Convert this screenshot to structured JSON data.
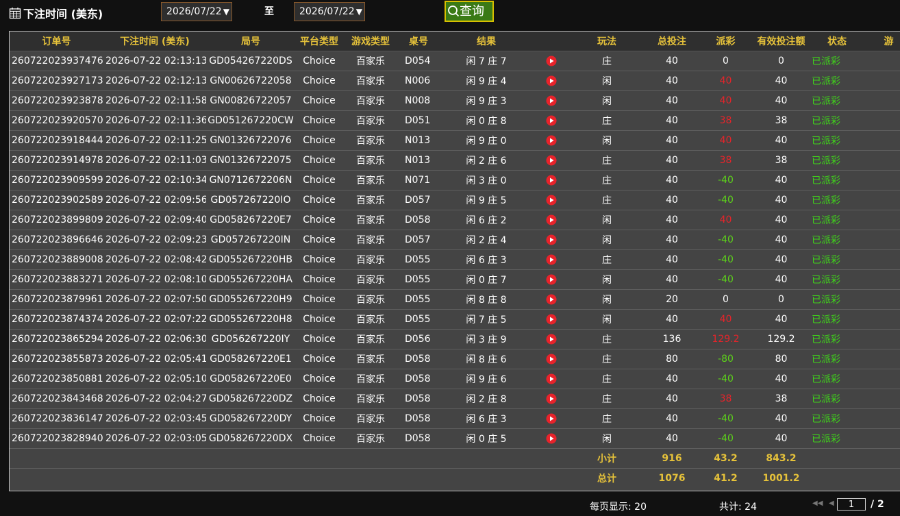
{
  "filter": {
    "label": "下注时间 (美东)",
    "start_date": "2026/07/22",
    "to_label": "至",
    "end_date": "2026/07/22",
    "query_label": "查询"
  },
  "table": {
    "headers": [
      "订单号",
      "下注时间 (美东)",
      "局号",
      "平台类型",
      "游戏类型",
      "桌号",
      "结果",
      "",
      "玩法",
      "总投注",
      "派彩",
      "有效投注额",
      "状态",
      "游"
    ],
    "rows": [
      {
        "order": "260722023937476",
        "time": "2026-07-22 02:13:13",
        "round": "GD054267220DS",
        "platform": "Choice",
        "game": "百家乐",
        "table": "D054",
        "result": "闲 7 庄 7",
        "bet": "庄",
        "stake": "40",
        "payout": "0",
        "payout_type": "zero",
        "valid": "0",
        "status": "已派彩"
      },
      {
        "order": "260722023927173",
        "time": "2026-07-22 02:12:13",
        "round": "GN00626722058",
        "platform": "Choice",
        "game": "百家乐",
        "table": "N006",
        "result": "闲 9 庄 4",
        "bet": "闲",
        "stake": "40",
        "payout": "40",
        "payout_type": "win",
        "valid": "40",
        "status": "已派彩"
      },
      {
        "order": "260722023923878",
        "time": "2026-07-22 02:11:58",
        "round": "GN00826722057",
        "platform": "Choice",
        "game": "百家乐",
        "table": "N008",
        "result": "闲 9 庄 3",
        "bet": "闲",
        "stake": "40",
        "payout": "40",
        "payout_type": "win",
        "valid": "40",
        "status": "已派彩"
      },
      {
        "order": "260722023920570",
        "time": "2026-07-22 02:11:36",
        "round": "GD051267220CW",
        "platform": "Choice",
        "game": "百家乐",
        "table": "D051",
        "result": "闲 0 庄 8",
        "bet": "庄",
        "stake": "40",
        "payout": "38",
        "payout_type": "win",
        "valid": "38",
        "status": "已派彩"
      },
      {
        "order": "260722023918444",
        "time": "2026-07-22 02:11:25",
        "round": "GN01326722076",
        "platform": "Choice",
        "game": "百家乐",
        "table": "N013",
        "result": "闲 9 庄 0",
        "bet": "闲",
        "stake": "40",
        "payout": "40",
        "payout_type": "win",
        "valid": "40",
        "status": "已派彩"
      },
      {
        "order": "260722023914978",
        "time": "2026-07-22 02:11:03",
        "round": "GN01326722075",
        "platform": "Choice",
        "game": "百家乐",
        "table": "N013",
        "result": "闲 2 庄 6",
        "bet": "庄",
        "stake": "40",
        "payout": "38",
        "payout_type": "win",
        "valid": "38",
        "status": "已派彩"
      },
      {
        "order": "260722023909599",
        "time": "2026-07-22 02:10:34",
        "round": "GN0712672206N",
        "platform": "Choice",
        "game": "百家乐",
        "table": "N071",
        "result": "闲 3 庄 0",
        "bet": "庄",
        "stake": "40",
        "payout": "-40",
        "payout_type": "neg",
        "valid": "40",
        "status": "已派彩"
      },
      {
        "order": "260722023902589",
        "time": "2026-07-22 02:09:56",
        "round": "GD057267220IO",
        "platform": "Choice",
        "game": "百家乐",
        "table": "D057",
        "result": "闲 9 庄 5",
        "bet": "庄",
        "stake": "40",
        "payout": "-40",
        "payout_type": "neg",
        "valid": "40",
        "status": "已派彩"
      },
      {
        "order": "260722023899809",
        "time": "2026-07-22 02:09:40",
        "round": "GD058267220E7",
        "platform": "Choice",
        "game": "百家乐",
        "table": "D058",
        "result": "闲 6 庄 2",
        "bet": "闲",
        "stake": "40",
        "payout": "40",
        "payout_type": "win",
        "valid": "40",
        "status": "已派彩"
      },
      {
        "order": "260722023896646",
        "time": "2026-07-22 02:09:23",
        "round": "GD057267220IN",
        "platform": "Choice",
        "game": "百家乐",
        "table": "D057",
        "result": "闲 2 庄 4",
        "bet": "闲",
        "stake": "40",
        "payout": "-40",
        "payout_type": "neg",
        "valid": "40",
        "status": "已派彩"
      },
      {
        "order": "260722023889008",
        "time": "2026-07-22 02:08:42",
        "round": "GD055267220HB",
        "platform": "Choice",
        "game": "百家乐",
        "table": "D055",
        "result": "闲 6 庄 3",
        "bet": "庄",
        "stake": "40",
        "payout": "-40",
        "payout_type": "neg",
        "valid": "40",
        "status": "已派彩"
      },
      {
        "order": "260722023883271",
        "time": "2026-07-22 02:08:10",
        "round": "GD055267220HA",
        "platform": "Choice",
        "game": "百家乐",
        "table": "D055",
        "result": "闲 0 庄 7",
        "bet": "闲",
        "stake": "40",
        "payout": "-40",
        "payout_type": "neg",
        "valid": "40",
        "status": "已派彩"
      },
      {
        "order": "260722023879961",
        "time": "2026-07-22 02:07:50",
        "round": "GD055267220H9",
        "platform": "Choice",
        "game": "百家乐",
        "table": "D055",
        "result": "闲 8 庄 8",
        "bet": "闲",
        "stake": "20",
        "payout": "0",
        "payout_type": "zero",
        "valid": "0",
        "status": "已派彩"
      },
      {
        "order": "260722023874374",
        "time": "2026-07-22 02:07:22",
        "round": "GD055267220H8",
        "platform": "Choice",
        "game": "百家乐",
        "table": "D055",
        "result": "闲 7 庄 5",
        "bet": "闲",
        "stake": "40",
        "payout": "40",
        "payout_type": "win",
        "valid": "40",
        "status": "已派彩"
      },
      {
        "order": "260722023865294",
        "time": "2026-07-22 02:06:30",
        "round": "GD056267220IY",
        "platform": "Choice",
        "game": "百家乐",
        "table": "D056",
        "result": "闲 3 庄 9",
        "bet": "庄",
        "stake": "136",
        "payout": "129.2",
        "payout_type": "win",
        "valid": "129.2",
        "status": "已派彩"
      },
      {
        "order": "260722023855873",
        "time": "2026-07-22 02:05:41",
        "round": "GD058267220E1",
        "platform": "Choice",
        "game": "百家乐",
        "table": "D058",
        "result": "闲 8 庄 6",
        "bet": "庄",
        "stake": "80",
        "payout": "-80",
        "payout_type": "neg",
        "valid": "80",
        "status": "已派彩"
      },
      {
        "order": "260722023850881",
        "time": "2026-07-22 02:05:10",
        "round": "GD058267220E0",
        "platform": "Choice",
        "game": "百家乐",
        "table": "D058",
        "result": "闲 9 庄 6",
        "bet": "庄",
        "stake": "40",
        "payout": "-40",
        "payout_type": "neg",
        "valid": "40",
        "status": "已派彩"
      },
      {
        "order": "260722023843468",
        "time": "2026-07-22 02:04:27",
        "round": "GD058267220DZ",
        "platform": "Choice",
        "game": "百家乐",
        "table": "D058",
        "result": "闲 2 庄 8",
        "bet": "庄",
        "stake": "40",
        "payout": "38",
        "payout_type": "win",
        "valid": "38",
        "status": "已派彩"
      },
      {
        "order": "260722023836147",
        "time": "2026-07-22 02:03:45",
        "round": "GD058267220DY",
        "platform": "Choice",
        "game": "百家乐",
        "table": "D058",
        "result": "闲 6 庄 3",
        "bet": "庄",
        "stake": "40",
        "payout": "-40",
        "payout_type": "neg",
        "valid": "40",
        "status": "已派彩"
      },
      {
        "order": "260722023828940",
        "time": "2026-07-22 02:03:05",
        "round": "GD058267220DX",
        "platform": "Choice",
        "game": "百家乐",
        "table": "D058",
        "result": "闲 0 庄 5",
        "bet": "闲",
        "stake": "40",
        "payout": "-40",
        "payout_type": "neg",
        "valid": "40",
        "status": "已派彩"
      }
    ],
    "subtotal": {
      "label": "小计",
      "stake": "916",
      "payout": "43.2",
      "valid": "843.2"
    },
    "total": {
      "label": "总计",
      "stake": "1076",
      "payout": "41.2",
      "valid": "1001.2"
    }
  },
  "pager": {
    "per_page": "每页显示: 20",
    "total_count": "共计: 24",
    "current_page": "1",
    "total_pages": "/ 2"
  },
  "colors": {
    "header_text": "#e6c23a",
    "payout_win": "#e6242a",
    "payout_negative": "#5dd21a",
    "status": "#3fd31a",
    "query_button": "#3a7a16"
  }
}
